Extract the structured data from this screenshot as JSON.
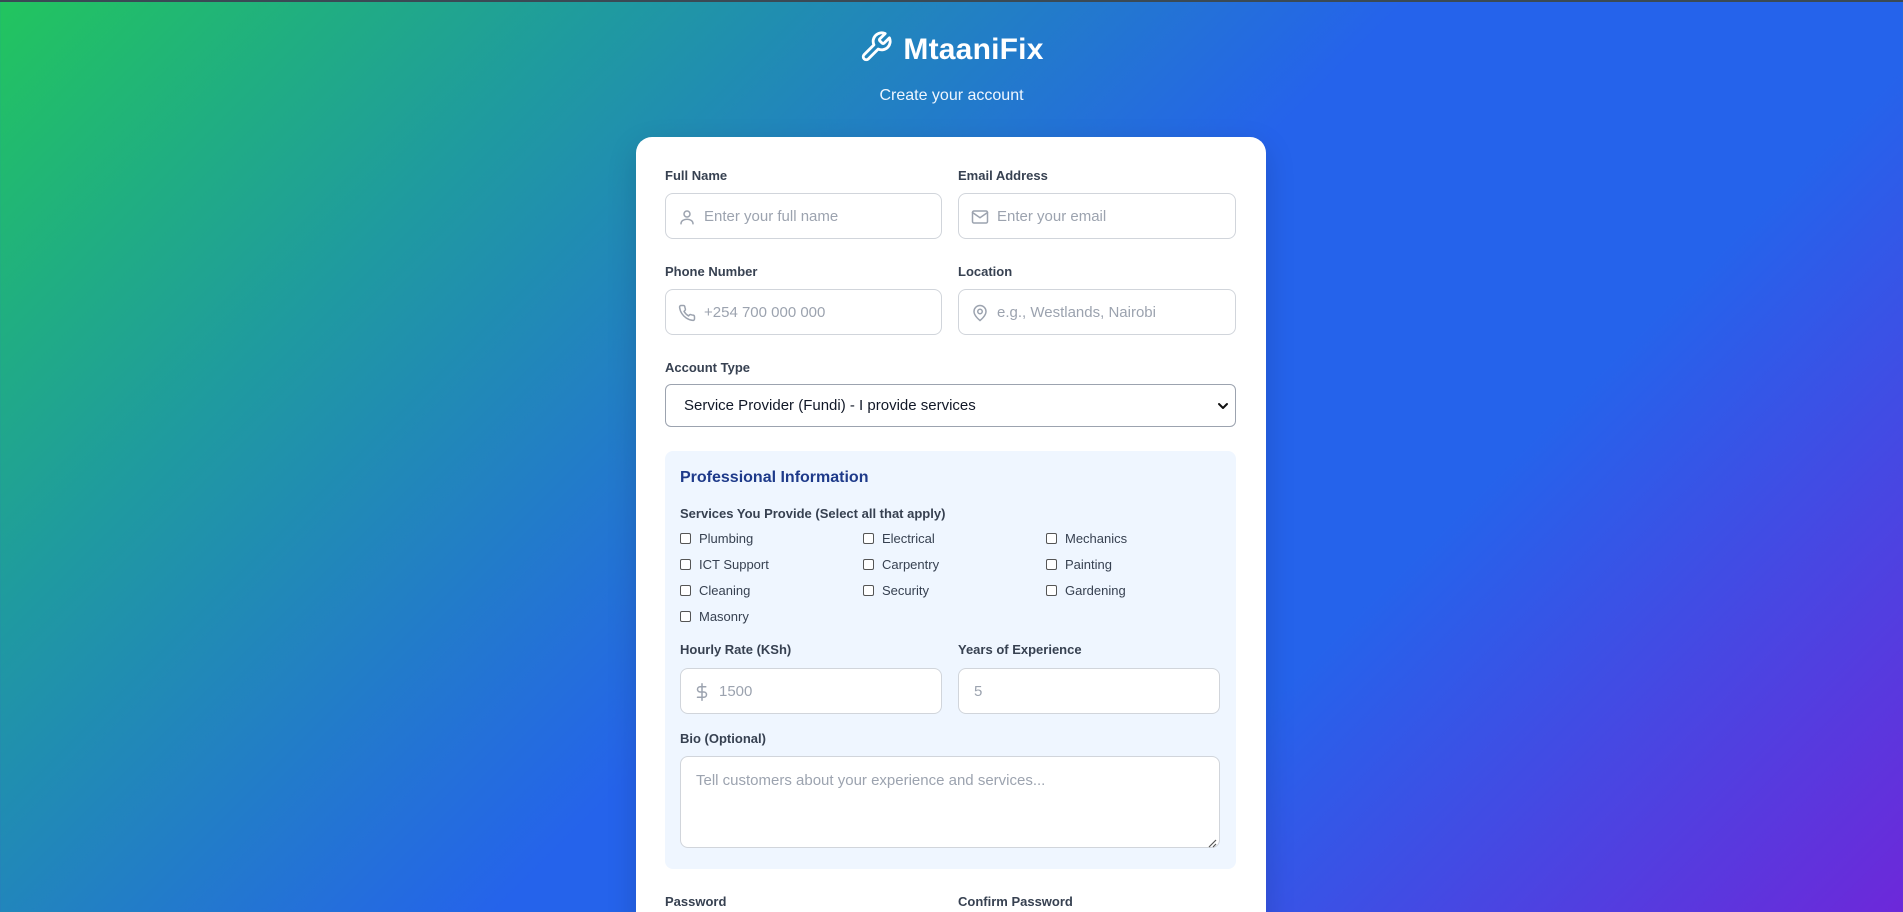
{
  "brand": {
    "title": "MtaaniFix",
    "subtitle": "Create your account",
    "icon": "wrench-icon"
  },
  "form": {
    "full_name": {
      "label": "Full Name",
      "placeholder": "Enter your full name",
      "icon": "user-icon"
    },
    "email": {
      "label": "Email Address",
      "placeholder": "Enter your email",
      "icon": "mail-icon"
    },
    "phone": {
      "label": "Phone Number",
      "placeholder": "+254 700 000 000",
      "icon": "phone-icon"
    },
    "location": {
      "label": "Location",
      "placeholder": "e.g., Westlands, Nairobi",
      "icon": "map-pin-icon"
    },
    "account_type": {
      "label": "Account Type",
      "selected": "Service Provider (Fundi) - I provide services"
    },
    "professional": {
      "title": "Professional Information",
      "services_label": "Services You Provide (Select all that apply)",
      "services": [
        "Plumbing",
        "Electrical",
        "Mechanics",
        "ICT Support",
        "Carpentry",
        "Painting",
        "Cleaning",
        "Security",
        "Gardening",
        "Masonry"
      ],
      "hourly_rate": {
        "label": "Hourly Rate (KSh)",
        "placeholder": "1500",
        "icon": "dollar-icon"
      },
      "experience": {
        "label": "Years of Experience",
        "placeholder": "5"
      },
      "bio": {
        "label": "Bio (Optional)",
        "placeholder": "Tell customers about your experience and services..."
      }
    },
    "password": {
      "label": "Password"
    },
    "confirm_password": {
      "label": "Confirm Password"
    }
  },
  "colors": {
    "accent": "#2563eb",
    "panel_bg": "#eff6ff",
    "panel_title": "#1e3a8a"
  }
}
